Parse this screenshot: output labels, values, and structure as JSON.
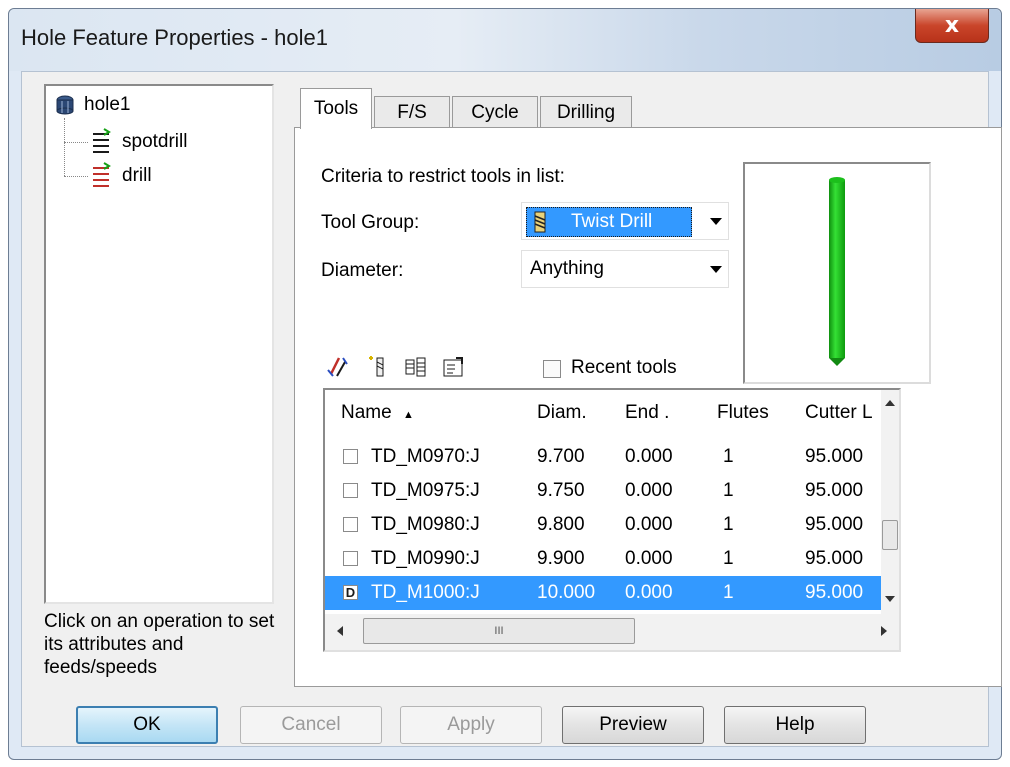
{
  "window": {
    "title": "Hole Feature Properties - hole1",
    "close_label": "x"
  },
  "tree": {
    "root": {
      "label": "hole1",
      "icon": "cylinder-icon"
    },
    "children": [
      {
        "label": "spotdrill",
        "icon": "spotdrill-icon"
      },
      {
        "label": "drill",
        "icon": "drill-icon"
      }
    ]
  },
  "hint": "Click on an operation to set its attributes and feeds/speeds",
  "tabs": [
    {
      "label": "Tools",
      "active": true
    },
    {
      "label": "F/S",
      "active": false
    },
    {
      "label": "Cycle",
      "active": false
    },
    {
      "label": "Drilling",
      "active": false
    }
  ],
  "tools_tab": {
    "criteria_label": "Criteria to restrict tools in list:",
    "tool_group_label": "Tool Group:",
    "tool_group_value": "Twist Drill",
    "diameter_label": "Diameter:",
    "diameter_value": "Anything",
    "recent_tools_label": "Recent tools",
    "recent_tools_checked": false
  },
  "tool_list": {
    "columns": [
      "Name",
      "Diam.",
      "End .",
      "Flutes",
      "Cutter L"
    ],
    "sort_indicator": "▲",
    "rows": [
      {
        "name": "TD_M0970:J",
        "diam": "9.700",
        "end": "0.000",
        "flutes": "1",
        "cutter_len": "95.000",
        "selected": false,
        "marker": ""
      },
      {
        "name": "TD_M0975:J",
        "diam": "9.750",
        "end": "0.000",
        "flutes": "1",
        "cutter_len": "95.000",
        "selected": false,
        "marker": ""
      },
      {
        "name": "TD_M0980:J",
        "diam": "9.800",
        "end": "0.000",
        "flutes": "1",
        "cutter_len": "95.000",
        "selected": false,
        "marker": ""
      },
      {
        "name": "TD_M0990:J",
        "diam": "9.900",
        "end": "0.000",
        "flutes": "1",
        "cutter_len": "95.000",
        "selected": false,
        "marker": ""
      },
      {
        "name": "TD_M1000:J",
        "diam": "10.000",
        "end": "0.000",
        "flutes": "1",
        "cutter_len": "95.000",
        "selected": true,
        "marker": "D"
      }
    ],
    "hscroll_grip": "III"
  },
  "buttons": {
    "ok": "OK",
    "cancel": "Cancel",
    "apply": "Apply",
    "preview": "Preview",
    "help": "Help"
  },
  "colors": {
    "selection": "#3399ff",
    "drill_preview": "#22cc22"
  }
}
